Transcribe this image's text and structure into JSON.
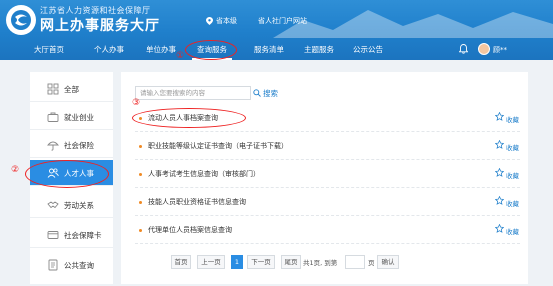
{
  "header": {
    "org_small": "江苏省人力资源和社会保障厅",
    "title": "网上办事服务大厅",
    "location": "省本级",
    "outside_link": "省人社门户网站",
    "user_name": "顾**"
  },
  "nav": {
    "items": [
      {
        "label": "大厅首页"
      },
      {
        "label": "个人办事"
      },
      {
        "label": "单位办事"
      },
      {
        "label": "查询服务"
      },
      {
        "label": "服务清单"
      },
      {
        "label": "主题服务"
      },
      {
        "label": "公示公告"
      }
    ],
    "active_index": 3
  },
  "markers": {
    "m1": "①",
    "m2": "②",
    "m3": "③"
  },
  "sidebar": {
    "items": [
      {
        "label": "全部",
        "icon": "grid-icon"
      },
      {
        "label": "就业创业",
        "icon": "briefcase-icon"
      },
      {
        "label": "社会保险",
        "icon": "umbrella-icon"
      },
      {
        "label": "人才人事",
        "icon": "people-icon"
      },
      {
        "label": "劳动关系",
        "icon": "handshake-icon"
      },
      {
        "label": "社会保障卡",
        "icon": "card-icon"
      },
      {
        "label": "公共查询",
        "icon": "document-icon"
      }
    ],
    "active_index": 3
  },
  "search": {
    "placeholder": "请输入您要搜索的内容",
    "button": "搜索"
  },
  "list": {
    "rows": [
      {
        "title": "流动人员人事档案查询",
        "fav": "收藏"
      },
      {
        "title": "职业技能等级认定证书查询（电子证书下载）",
        "fav": "收藏"
      },
      {
        "title": "人事考试考生信息查询（审核部门）",
        "fav": "收藏"
      },
      {
        "title": "技能人员职业资格证书信息查询",
        "fav": "收藏"
      },
      {
        "title": "代理单位人员档案信息查询",
        "fav": "收藏"
      }
    ]
  },
  "pager": {
    "first": "首页",
    "prev": "上一页",
    "current": "1",
    "next": "下一页",
    "last": "尾页",
    "summary": "共1页, 到第",
    "page_unit": "页",
    "confirm": "确认"
  },
  "colors": {
    "brand": "#1f7fcb",
    "active_side": "#2a8de3",
    "annotation": "#e22",
    "dot": "#f08a24"
  }
}
